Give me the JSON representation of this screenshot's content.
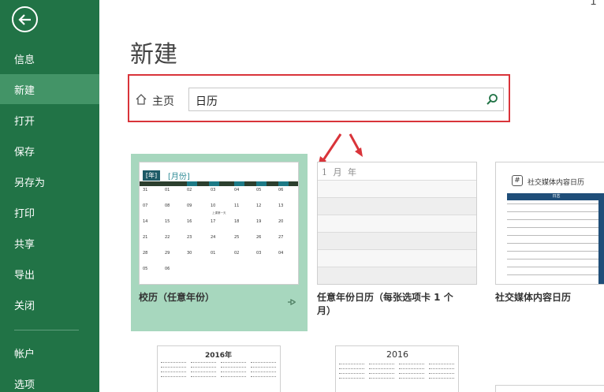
{
  "sidebar": {
    "items": [
      {
        "label": "信息",
        "active": false
      },
      {
        "label": "新建",
        "active": true
      },
      {
        "label": "打开",
        "active": false
      },
      {
        "label": "保存",
        "active": false
      },
      {
        "label": "另存为",
        "active": false
      },
      {
        "label": "打印",
        "active": false
      },
      {
        "label": "共享",
        "active": false
      },
      {
        "label": "导出",
        "active": false
      },
      {
        "label": "关闭",
        "active": false
      },
      {
        "label": "帐户",
        "active": false
      },
      {
        "label": "选项",
        "active": false
      }
    ]
  },
  "header": {
    "title": "新建",
    "corner_fragment": "1"
  },
  "search": {
    "home_label": "主页",
    "value": "日历"
  },
  "templates": [
    {
      "title": "校历（任意年份）",
      "selected": true,
      "thumb": {
        "year": "[年]",
        "month": "[月份]",
        "dates": [
          "31",
          "01",
          "02",
          "03",
          "04",
          "05",
          "06",
          "07",
          "08",
          "09",
          "10",
          "11",
          "12",
          "13",
          "14",
          "15",
          "16",
          "17",
          "18",
          "19",
          "20",
          "21",
          "22",
          "23",
          "24",
          "25",
          "26",
          "27",
          "28",
          "29",
          "30",
          "01",
          "02",
          "03",
          "04",
          "05",
          "06"
        ],
        "note": "上课第一天"
      }
    },
    {
      "title": "任意年份日历（每张选项卡 1 个月）",
      "selected": false,
      "thumb": {
        "heading": "1 月 年"
      }
    },
    {
      "title": "社交媒体内容日历",
      "selected": false,
      "thumb": {
        "heading": "社交媒体内容日历",
        "bar": "日志",
        "hash": "#"
      }
    },
    {
      "title": "",
      "thumb": {
        "heading": "2016年"
      }
    },
    {
      "title": "",
      "thumb": {
        "heading": "2016"
      }
    }
  ],
  "colors": {
    "sidebar": "#217346",
    "sidebar_active": "#439467",
    "frame": "#d9343a",
    "selected": "#a7d7be"
  }
}
